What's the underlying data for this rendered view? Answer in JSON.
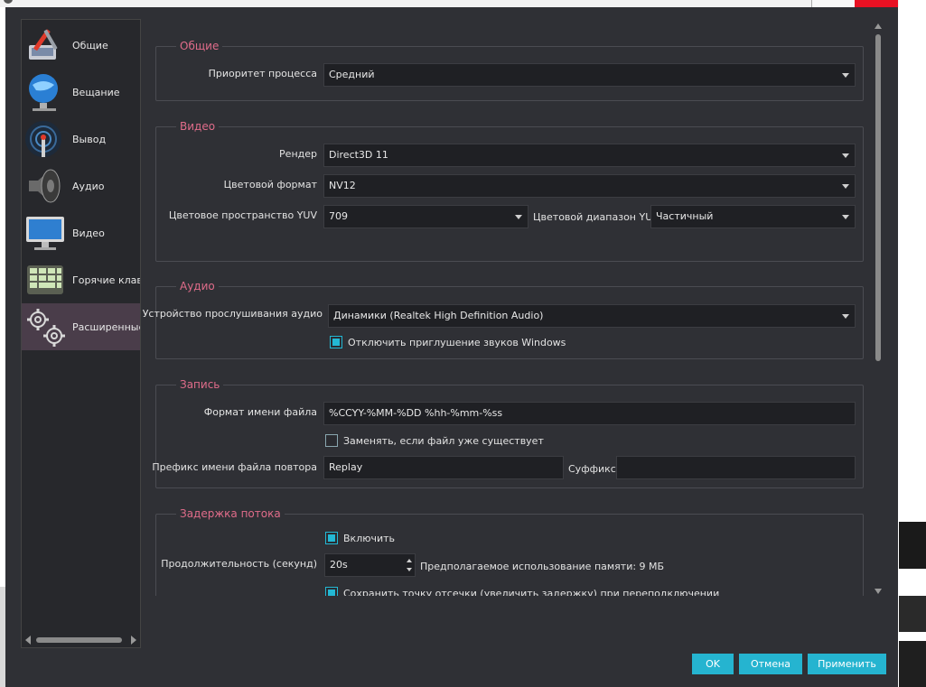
{
  "sidebar": {
    "items": [
      {
        "label": "Общие",
        "icon": "general-settings-icon"
      },
      {
        "label": "Вещание",
        "icon": "broadcast-globe-icon"
      },
      {
        "label": "Вывод",
        "icon": "output-antenna-icon"
      },
      {
        "label": "Аудио",
        "icon": "speaker-icon"
      },
      {
        "label": "Видео",
        "icon": "monitor-icon"
      },
      {
        "label": "Горячие клави",
        "icon": "keyboard-icon"
      },
      {
        "label": "Расширенные",
        "icon": "gears-icon"
      }
    ],
    "active_index": 6
  },
  "general": {
    "title": "Общие",
    "priority_label": "Приоритет процесса",
    "priority_value": "Средний"
  },
  "video": {
    "title": "Видео",
    "renderer_label": "Рендер",
    "renderer_value": "Direct3D 11",
    "color_format_label": "Цветовой формат",
    "color_format_value": "NV12",
    "color_space_label": "Цветовое пространство YUV",
    "color_space_value": "709",
    "color_range_label": "Цветовой диапазон YUV",
    "color_range_value": "Частичный"
  },
  "audio": {
    "title": "Аудио",
    "monitoring_device_label": "Устройство прослушивания аудио",
    "monitoring_device_value": "Динамики (Realtek High Definition Audio)",
    "disable_ducking_label": "Отключить приглушение звуков Windows",
    "disable_ducking_checked": true
  },
  "recording": {
    "title": "Запись",
    "filename_format_label": "Формат имени файла",
    "filename_format_value": "%CCYY-%MM-%DD %hh-%mm-%ss",
    "overwrite_label": "Заменять, если файл уже существует",
    "overwrite_checked": false,
    "replay_prefix_label": "Префикс имени файла повтора",
    "replay_prefix_value": "Replay",
    "suffix_label": "Суффикс",
    "suffix_value": ""
  },
  "stream_delay": {
    "title": "Задержка потока",
    "enable_label": "Включить",
    "enable_checked": true,
    "duration_label": "Продолжительность (секунд)",
    "duration_value": "20s",
    "memory_estimate": "Предполагаемое использование памяти: 9 МБ",
    "preserve_cutoff_label": "Сохранить точку отсечки (увеличить задержку) при переподключении",
    "preserve_cutoff_checked": true
  },
  "buttons": {
    "ok": "OK",
    "cancel": "Отмена",
    "apply": "Применить"
  },
  "colors": {
    "window_bg": "#2f3035",
    "accent": "#25b4d0",
    "group_title": "#e06c8a",
    "active_item": "#4a3d4a"
  }
}
